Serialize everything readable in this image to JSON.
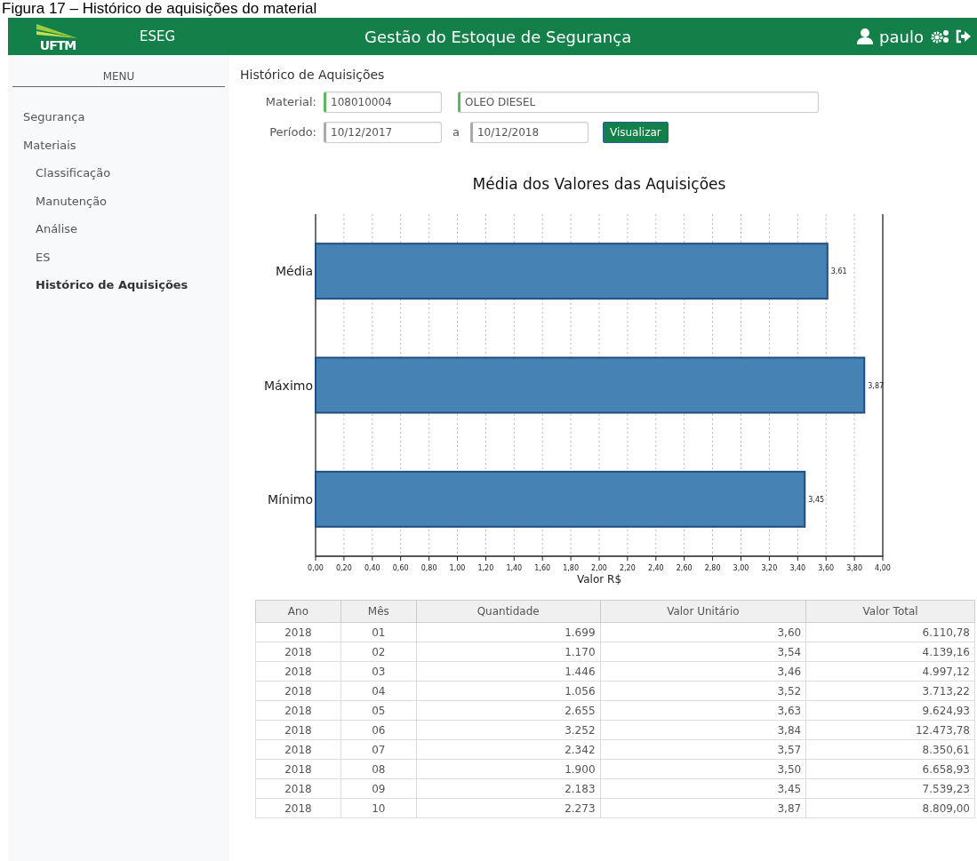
{
  "caption": "Figura 17 – Histórico de aquisições do material",
  "header": {
    "logo_text": "UFTM",
    "app": "ESEG",
    "title": "Gestão do Estoque de Segurança",
    "user": "paulo"
  },
  "sidebar": {
    "heading": "MENU",
    "items": [
      {
        "label": "Segurança",
        "selected": false
      },
      {
        "label": "Materiais",
        "selected": false,
        "children": [
          {
            "label": "Classificação",
            "selected": false
          },
          {
            "label": "Manutenção",
            "selected": false
          },
          {
            "label": "Análise",
            "selected": false
          },
          {
            "label": "ES",
            "selected": false
          },
          {
            "label": "Histórico de Aquisições",
            "selected": true
          }
        ]
      }
    ]
  },
  "page_title": "Histórico de Aquisições",
  "form": {
    "material_label": "Material:",
    "material_code": "108010004",
    "material_name": "OLEO DIESEL",
    "period_label": "Período:",
    "date_from": "10/12/2017",
    "separator": "a",
    "date_to": "10/12/2018",
    "button": "Visualizar"
  },
  "chart_data": {
    "type": "bar",
    "orientation": "horizontal",
    "title": "Média dos Valores das Aquisições",
    "xlabel": "Valor R$",
    "grid": true,
    "categories": [
      "Média",
      "Máximo",
      "Mínimo"
    ],
    "values": [
      3.61,
      3.87,
      3.45
    ],
    "value_labels": [
      "3,61",
      "3,87",
      "3,45"
    ],
    "xlim": [
      0,
      4
    ],
    "xticks": [
      {
        "value": 0,
        "label": "0,00"
      },
      {
        "value": 0.2,
        "label": "0,20"
      },
      {
        "value": 0.4,
        "label": "0,40"
      },
      {
        "value": 0.6,
        "label": "0,60"
      },
      {
        "value": 0.8,
        "label": "0,80"
      },
      {
        "value": 1,
        "label": "1,00"
      },
      {
        "value": 1.2,
        "label": "1,20"
      },
      {
        "value": 1.4,
        "label": "1,40"
      },
      {
        "value": 1.6,
        "label": "1,60"
      },
      {
        "value": 1.8,
        "label": "1,80"
      },
      {
        "value": 2,
        "label": "2,00"
      },
      {
        "value": 2.2,
        "label": "2,20"
      },
      {
        "value": 2.4,
        "label": "2,40"
      },
      {
        "value": 2.6,
        "label": "2,60"
      },
      {
        "value": 2.8,
        "label": "2,80"
      },
      {
        "value": 3,
        "label": "3,00"
      },
      {
        "value": 3.2,
        "label": "3,20"
      },
      {
        "value": 3.4,
        "label": "3,40"
      },
      {
        "value": 3.6,
        "label": "3,60"
      },
      {
        "value": 3.8,
        "label": "3,80"
      },
      {
        "value": 4,
        "label": "4,00"
      }
    ]
  },
  "table": {
    "columns": [
      "Ano",
      "Mês",
      "Quantidade",
      "Valor Unitário",
      "Valor Total"
    ],
    "rows": [
      [
        "2018",
        "01",
        "1.699",
        "3,60",
        "6.110,78"
      ],
      [
        "2018",
        "02",
        "1.170",
        "3,54",
        "4.139,16"
      ],
      [
        "2018",
        "03",
        "1.446",
        "3,46",
        "4.997,12"
      ],
      [
        "2018",
        "04",
        "1.056",
        "3,52",
        "3.713,22"
      ],
      [
        "2018",
        "05",
        "2.655",
        "3,63",
        "9.624,93"
      ],
      [
        "2018",
        "06",
        "3.252",
        "3,84",
        "12.473,78"
      ],
      [
        "2018",
        "07",
        "2.342",
        "3,57",
        "8.350,61"
      ],
      [
        "2018",
        "08",
        "1.900",
        "3,50",
        "6.658,93"
      ],
      [
        "2018",
        "09",
        "2.183",
        "3,45",
        "7.539,23"
      ],
      [
        "2018",
        "10",
        "2.273",
        "3,87",
        "8.809,00"
      ]
    ]
  }
}
